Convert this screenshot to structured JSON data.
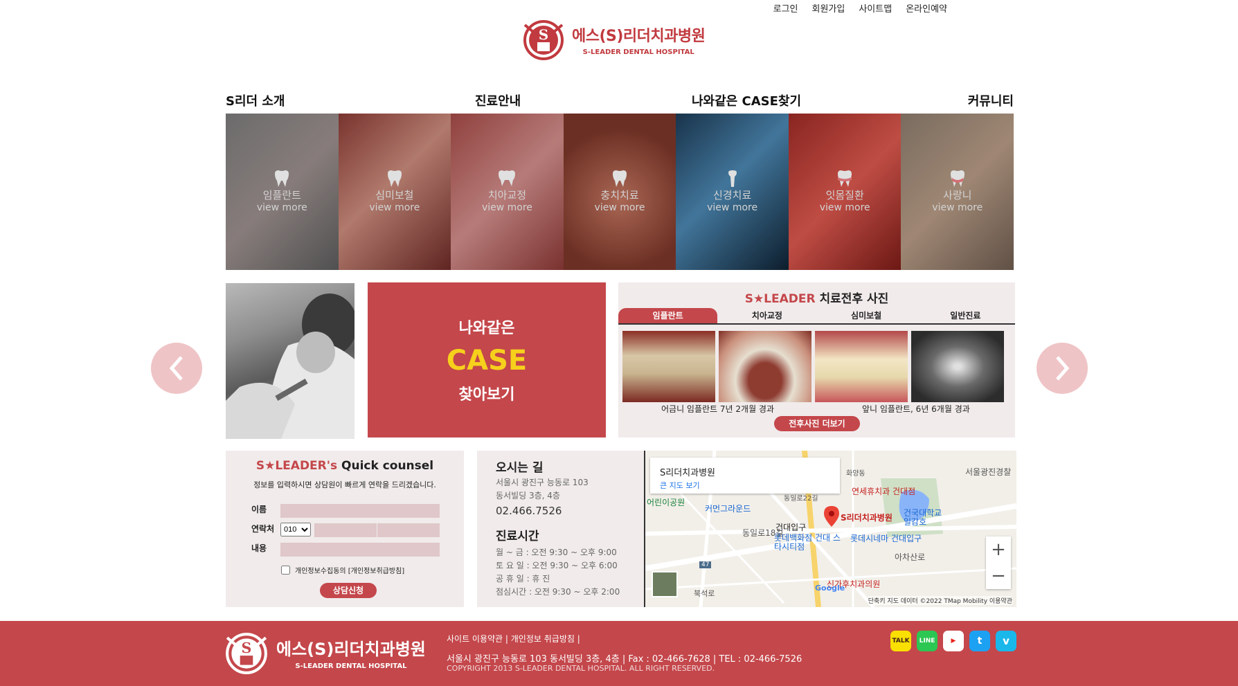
{
  "util_links": [
    "로그인",
    "회원가입",
    "사이트맵",
    "온라인예약"
  ],
  "logo": {
    "name": "에스(S)리더치과병원",
    "sub": "S-LEADER DENTAL HOSPITAL"
  },
  "nav": [
    "S리더 소개",
    "진료안내",
    "나와같은 CASE찾기",
    "커뮤니티"
  ],
  "tiles": [
    {
      "name": "임플란트",
      "more": "view more"
    },
    {
      "name": "심미보철",
      "more": "view more"
    },
    {
      "name": "치아교정",
      "more": "view more"
    },
    {
      "name": "충치치료",
      "more": "view more"
    },
    {
      "name": "신경치료",
      "more": "view more"
    },
    {
      "name": "잇몸질환",
      "more": "view more"
    },
    {
      "name": "사랑니",
      "more": "view more"
    }
  ],
  "case_box": {
    "line1": "나와같은",
    "line2": "CASE",
    "line3": "찾아보기"
  },
  "before_after": {
    "title_brand": "S★LEADER",
    "title_rest": " 치료전후 사진",
    "tabs": [
      "임플란트",
      "치아교정",
      "심미보철",
      "일반진료"
    ],
    "captions": [
      "어금니 임플란트 7년 2개월 경과",
      "앞니 임플란트, 6년 6개월 경과"
    ],
    "more": "전후사진 더보기"
  },
  "counsel": {
    "title_brand": "S★LEADER's",
    "title_rest": " Quick counsel",
    "desc": "정보를 입력하시면 상담원이 빠르게 연락을 드리겠습니다.",
    "label_name": "이름",
    "label_phone": "연락처",
    "label_content": "내용",
    "phone_prefix": "010",
    "agree": "개인정보수집동의 [개인정보취급방침]",
    "submit": "상담신청"
  },
  "directions": {
    "title": "오시는 길",
    "addr1": "서울시 광진구 능동로 103",
    "addr2": "동서빌딩 3층, 4층",
    "phone": "02.466.7526",
    "hours_title": "진료시간",
    "hours": [
      "월 ~ 금 : 오전 9:30 ~ 오후 9:00",
      "토 요 일 : 오전 9:30 ~ 오후 6:00",
      "공 휴 일 : 휴 진",
      "점심시간 : 오전 9:30 ~ 오후 2:00"
    ]
  },
  "map": {
    "place": "S리더치과병원",
    "bigmap": "큰 지도 보기",
    "labels": [
      "S리더치과병원",
      "연세휴치과 건대점",
      "커먼그라운드",
      "건대입구",
      "롯데백화점 건대 스타시티점",
      "롯데시네마 건대입구",
      "건국대학교 일감호",
      "어린이공원",
      "서울광진경찰",
      "신가후치과의원",
      "아차산로",
      "동일로22길",
      "동일로18길",
      "화양동",
      "북석로",
      "47"
    ],
    "attribution": "단축키  지도 데이터 ©2022 TMap Mobility  이용약관",
    "google": "Google"
  },
  "footer": {
    "logo_name": "에스(S)리더치과병원",
    "logo_sub": "S-LEADER DENTAL HOSPITAL",
    "links": "사이트 이용약관 | 개인정보 취급방침 |",
    "address": "서울시 광진구 능동로 103 동서빌딩 3층, 4층 | Fax : 02-466-7628 | TEL : 02-466-7526",
    "copyright": "COPYRIGHT 2013 S-LEADER DENTAL HOSPITAL. ALL RIGHT RESERVED.",
    "sns": [
      "kakaotalk-icon",
      "line-icon",
      "youtube-icon",
      "twitter-icon",
      "vimeo-icon"
    ]
  },
  "colors": {
    "brand": "#c4474b",
    "accent": "#f6d11c",
    "panel": "#f1ebeb",
    "arrow": "#efc4c6"
  }
}
